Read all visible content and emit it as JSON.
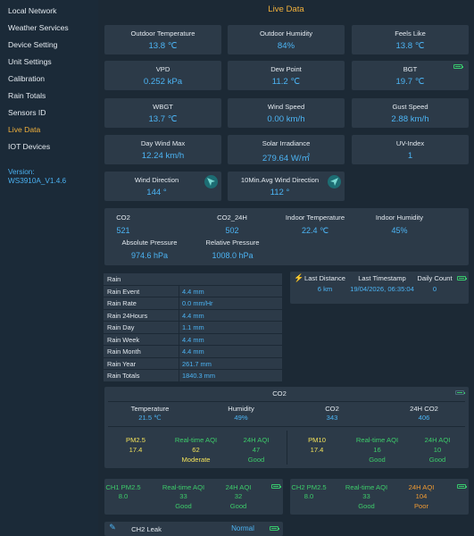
{
  "sidebar": {
    "items": [
      {
        "label": "Local Network"
      },
      {
        "label": "Weather Services"
      },
      {
        "label": "Device Setting"
      },
      {
        "label": "Unit Settings"
      },
      {
        "label": "Calibration"
      },
      {
        "label": "Rain Totals"
      },
      {
        "label": "Sensors ID"
      },
      {
        "label": "Live Data"
      },
      {
        "label": "IOT Devices"
      }
    ],
    "version_label": "Version:",
    "version_value": "WS3910A_V1.4.6"
  },
  "page_title": "Live Data",
  "cards": {
    "outdoor_temp": {
      "label": "Outdoor Temperature",
      "value": "13.8 ℃"
    },
    "outdoor_humidity": {
      "label": "Outdoor Humidity",
      "value": "84%"
    },
    "feels_like": {
      "label": "Feels Like",
      "value": "13.8 ℃"
    },
    "vpd": {
      "label": "VPD",
      "value": "0.252 kPa"
    },
    "dew_point": {
      "label": "Dew Point",
      "value": "11.2 ℃"
    },
    "bgt": {
      "label": "BGT",
      "value": "19.7 ℃"
    },
    "wbgt": {
      "label": "WBGT",
      "value": "13.7 ℃"
    },
    "wind_speed": {
      "label": "Wind Speed",
      "value": "0.00 km/h"
    },
    "gust_speed": {
      "label": "Gust Speed",
      "value": "2.88 km/h"
    },
    "day_wind_max": {
      "label": "Day Wind Max",
      "value": "12.24 km/h"
    },
    "solar": {
      "label": "Solar Irradiance",
      "value": "279.64 W/㎡"
    },
    "uv": {
      "label": "UV-Index",
      "value": "1"
    },
    "wind_dir": {
      "label": "Wind Direction",
      "value": "144 °"
    },
    "avg_wind_dir": {
      "label": "10Min.Avg Wind Direction",
      "value": "112 °"
    }
  },
  "indoor": {
    "co2_label": "CO2",
    "co2_value": "521",
    "co2_24h_label": "CO2_24H",
    "co2_24h_value": "502",
    "temp_label": "Indoor Temperature",
    "temp_value": "22.4 ℃",
    "humidity_label": "Indoor Humidity",
    "humidity_value": "45%",
    "abs_pressure_label": "Absolute Pressure",
    "abs_pressure_value": "974.6 hPa",
    "rel_pressure_label": "Relative Pressure",
    "rel_pressure_value": "1008.0 hPa"
  },
  "rain": {
    "header": "Rain",
    "rows": [
      {
        "label": "Rain Event",
        "value": "4.4 mm"
      },
      {
        "label": "Rain Rate",
        "value": "0.0 mm/Hr"
      },
      {
        "label": "Rain 24Hours",
        "value": "4.4 mm"
      },
      {
        "label": "Rain Day",
        "value": "1.1 mm"
      },
      {
        "label": "Rain Week",
        "value": "4.4 mm"
      },
      {
        "label": "Rain Month",
        "value": "4.4 mm"
      },
      {
        "label": "Rain Year",
        "value": "261.7 mm"
      },
      {
        "label": "Rain Totals",
        "value": "1840.3 mm"
      }
    ]
  },
  "lightning": {
    "distance_label": "Last Distance",
    "distance_value": "6 km",
    "timestamp_label": "Last Timestamp",
    "timestamp_value": "19/04/2026, 06:35:04",
    "count_label": "Daily Count",
    "count_value": "0"
  },
  "co2_sensor": {
    "title": "CO2",
    "temp_label": "Temperature",
    "temp_value": "21.5 ℃",
    "humidity_label": "Humidity",
    "humidity_value": "49%",
    "co2_label": "CO2",
    "co2_value": "343",
    "co2_24h_label": "24H CO2",
    "co2_24h_value": "406",
    "pm25_label": "PM2.5",
    "pm25_value": "17.4",
    "pm25_rt_label": "Real-time AQI",
    "pm25_rt_value": "62",
    "pm25_rt_status": "Moderate",
    "pm25_24h_label": "24H AQI",
    "pm25_24h_value": "47",
    "pm25_24h_status": "Good",
    "pm10_label": "PM10",
    "pm10_value": "17.4",
    "pm10_rt_label": "Real-time AQI",
    "pm10_rt_value": "16",
    "pm10_rt_status": "Good",
    "pm10_24h_label": "24H AQI",
    "pm10_24h_value": "10",
    "pm10_24h_status": "Good"
  },
  "ch1": {
    "label": "CH1 PM2.5",
    "value": "8.0",
    "rt_label": "Real-time AQI",
    "rt_value": "33",
    "rt_status": "Good",
    "h24_label": "24H AQI",
    "h24_value": "32",
    "h24_status": "Good"
  },
  "ch2": {
    "label": "CH2 PM2.5",
    "value": "8.0",
    "rt_label": "Real-time AQI",
    "rt_value": "33",
    "rt_status": "Good",
    "h24_label": "24H AQI",
    "h24_value": "104",
    "h24_status": "Poor"
  },
  "leak": {
    "label": "CH2 Leak",
    "status": "Normal"
  },
  "colors": {
    "accent": "#f0b03c",
    "value": "#4cb4f4",
    "good": "#3dcc6a",
    "moderate": "#f2e25a",
    "poor": "#f09a32",
    "battery": "#38c86c"
  }
}
